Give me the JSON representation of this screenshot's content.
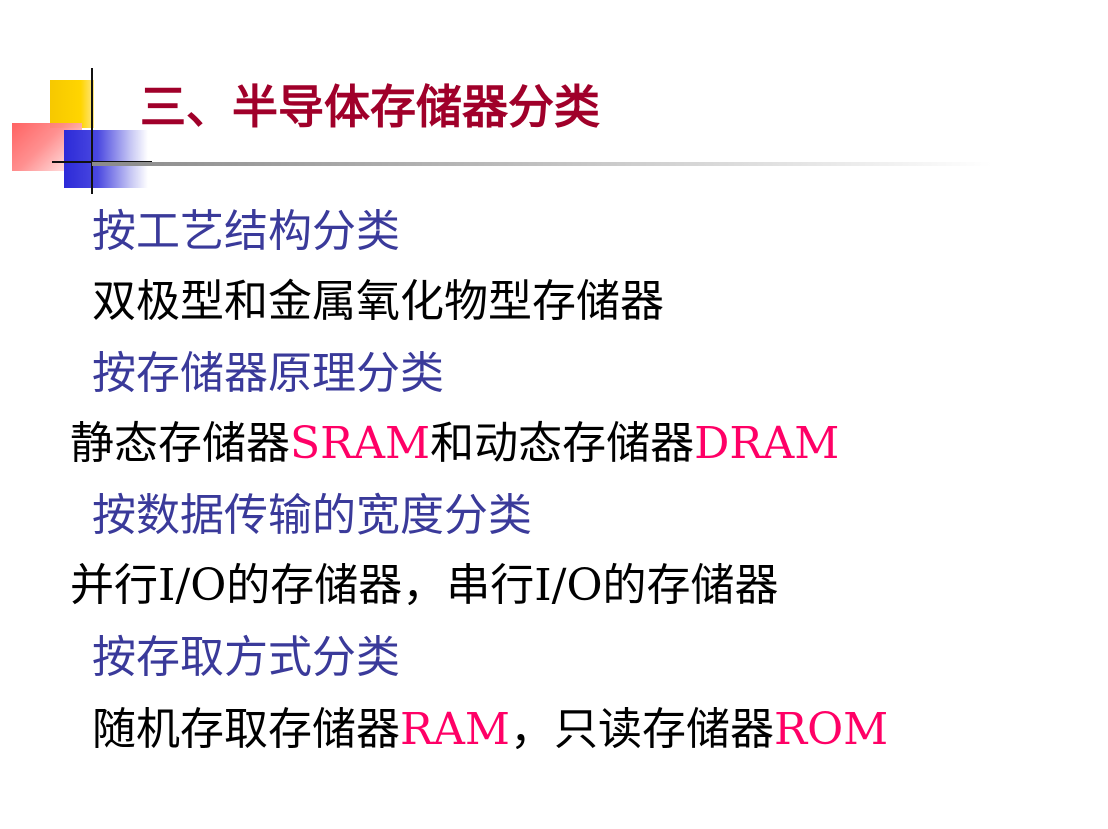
{
  "slide": {
    "title": "三、半导体存储器分类",
    "sections": [
      {
        "category": "按工艺结构分类",
        "detail": "双极型和金属氧化物型存储器"
      },
      {
        "category": "按存储器原理分类",
        "detail_parts": [
          "静态存储器",
          "SRAM",
          "和动态存储器",
          "DRAM"
        ]
      },
      {
        "category": "按数据传输的宽度分类",
        "detail": "并行I/O的存储器，串行I/O的存储器"
      },
      {
        "category": "按存取方式分类",
        "detail_parts": [
          "随机存取存储器",
          "RAM",
          "，只读存储器",
          "ROM"
        ]
      }
    ]
  },
  "colors": {
    "title": "#a0002a",
    "category": "#3a3a9a",
    "text": "#000000",
    "highlight": "#ff0066"
  }
}
